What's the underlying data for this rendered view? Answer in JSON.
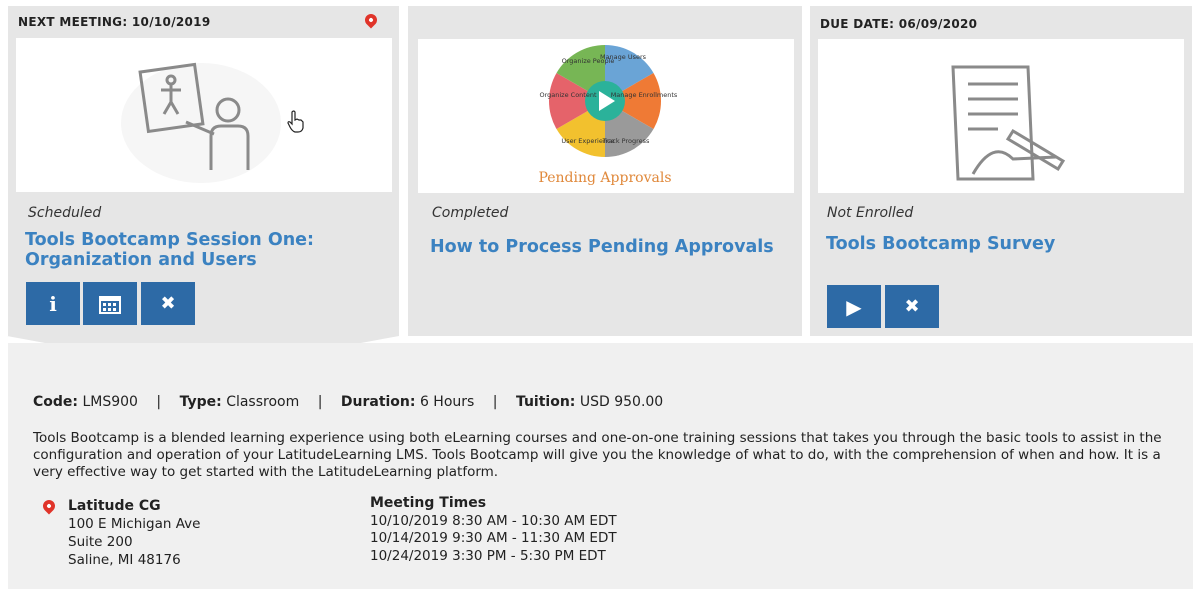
{
  "cards": [
    {
      "header": "NEXT MEETING: 10/10/2019",
      "status": "Scheduled",
      "title": "Tools Bootcamp Session One: Organization and Users",
      "buttons": [
        "info-icon",
        "calendar-icon",
        "close-icon"
      ]
    },
    {
      "header": "",
      "status": "Completed",
      "title": "How to Process Pending Approvals",
      "thumb_caption": "Pending Approvals",
      "wheel_labels": [
        "Organize People",
        "Manage Users",
        "Manage Enrollments",
        "Track Progress",
        "User Experience",
        "Organize Content"
      ]
    },
    {
      "header": "DUE DATE: 06/09/2020",
      "status": "Not Enrolled",
      "title": "Tools Bootcamp Survey",
      "buttons": [
        "play-icon",
        "close-icon"
      ]
    }
  ],
  "details": {
    "code_label": "Code:",
    "code": "LMS900",
    "type_label": "Type:",
    "type": "Classroom",
    "duration_label": "Duration:",
    "duration": "6 Hours",
    "tuition_label": "Tuition:",
    "tuition": "USD 950.00",
    "separator": "|",
    "description": "Tools Bootcamp is a blended learning experience using both eLearning courses and one-on-one training sessions that takes you through the basic tools to assist in the configuration and operation of your LatitudeLearning LMS. Tools Bootcamp will give you the knowledge of what to do, with the comprehension of when and how. It is a very effective way to get started with the LatitudeLearning platform.",
    "location": {
      "name": "Latitude CG",
      "line1": "100 E Michigan Ave",
      "line2": "Suite 200",
      "line3": "Saline, MI 48176"
    },
    "meeting_times_heading": "Meeting Times",
    "meeting_times": [
      "10/10/2019 8:30 AM - 10:30 AM EDT",
      "10/14/2019 9:30 AM - 11:30 AM EDT",
      "10/24/2019 3:30 PM - 5:30 PM EDT"
    ]
  },
  "colors": {
    "accent": "#3b82c1",
    "button": "#2d6aa6",
    "pin": "#e0342a",
    "card_bg": "#e6e6e6"
  }
}
